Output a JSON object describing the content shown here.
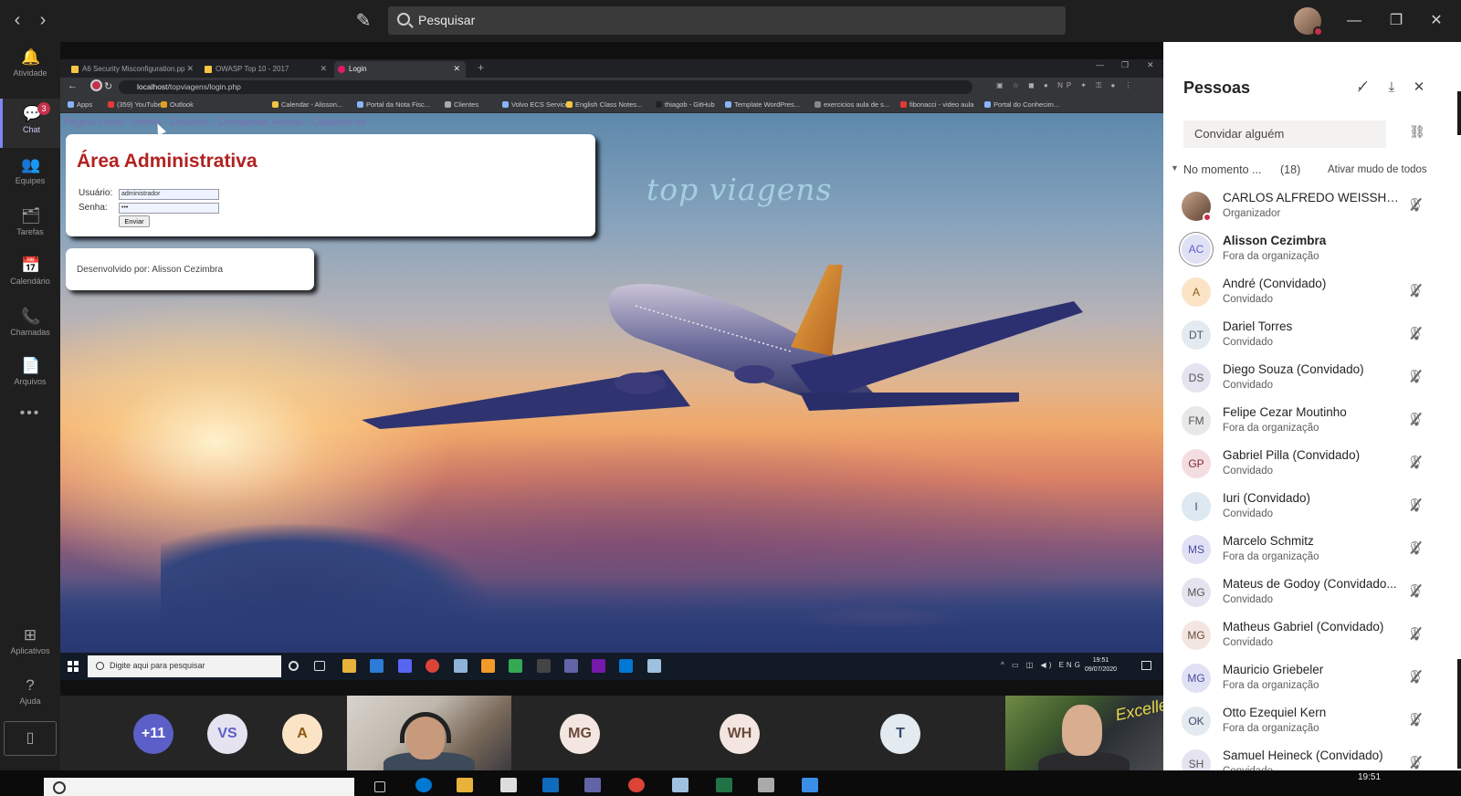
{
  "teams": {
    "search_placeholder": "Pesquisar",
    "rail": [
      {
        "label": "Atividade",
        "icon": "bell-icon",
        "glyph": "🔔"
      },
      {
        "label": "Chat",
        "icon": "chat-icon",
        "glyph": "💬",
        "badge": "3"
      },
      {
        "label": "Equipes",
        "icon": "teams-icon",
        "glyph": "👥"
      },
      {
        "label": "Tarefas",
        "icon": "tasks-icon",
        "glyph": "🗂"
      },
      {
        "label": "Calendário",
        "icon": "calendar-icon",
        "glyph": "📅"
      },
      {
        "label": "Chamadas",
        "icon": "phone-icon",
        "glyph": "📞"
      },
      {
        "label": "Arquivos",
        "icon": "files-icon",
        "glyph": "📄"
      },
      {
        "label": "Aplicativos",
        "icon": "apps-icon",
        "glyph": "⊞"
      },
      {
        "label": "Ajuda",
        "icon": "help-icon",
        "glyph": "?"
      }
    ]
  },
  "browser": {
    "tabs": [
      {
        "title": "A6 Security Misconfiguration.pp"
      },
      {
        "title": "OWASP Top 10 - 2017"
      },
      {
        "title": "Login"
      }
    ],
    "url_host": "localhost",
    "url_path": "/topviagens/login.php",
    "bookmarks": [
      "Apps",
      "(359) YouTube",
      "Outlook",
      "Calendar - Alisson...",
      "Portal da Nota Fisc...",
      "Clientes",
      "Volvo ECS Service",
      "English Class Notes...",
      "thiagob - GitHub",
      "Template WordPres...",
      "exercicios aula de s...",
      "fibonacci - video aula",
      "Portal do Conhecim..."
    ]
  },
  "site": {
    "nav": [
      "Página Inicial",
      "Hotéis",
      "Destinos",
      "Companias Aéreas",
      "Cadastre-se"
    ],
    "nav_separator": " - ",
    "admin_title": "Área Administrativa",
    "user_label": "Usuário:",
    "user_value": "administrador",
    "pass_label": "Senha:",
    "pass_value": "•••",
    "submit_label": "Enviar",
    "developer": "Desenvolvido por: Alisson Cezimbra",
    "brand": "top viagens"
  },
  "win_taskbar": {
    "search_placeholder": "Digite aqui para pesquisar",
    "lang": "ENG",
    "time": "19:51",
    "date": "09/07/2020"
  },
  "strip": {
    "participants": [
      "+11",
      "VS",
      "A",
      "MG",
      "WH",
      "T"
    ],
    "video2_text": "Excellent"
  },
  "host_clock": "19:51",
  "people": {
    "title": "Pessoas",
    "invite_placeholder": "Convidar alguém",
    "section_title": "No momento ...",
    "section_count": "(18)",
    "mute_all": "Ativar mudo de todos",
    "list": [
      {
        "initials": "",
        "name": "CARLOS ALFREDO WEISSHEI...",
        "role": "Organizador",
        "photo": true
      },
      {
        "initials": "AC",
        "name": "Alisson Cezimbra",
        "role": "Fora da organização",
        "bold": true
      },
      {
        "initials": "A",
        "name": "André (Convidado)",
        "role": "Convidado",
        "color": "#fbe4c6",
        "fg": "#8a5a10"
      },
      {
        "initials": "DT",
        "name": "Dariel Torres",
        "role": "Convidado",
        "color": "#e3eaf0",
        "fg": "#4a5a6a"
      },
      {
        "initials": "DS",
        "name": "Diego Souza (Convidado)",
        "role": "Convidado",
        "color": "#e6e3f0",
        "fg": "#555"
      },
      {
        "initials": "FM",
        "name": "Felipe Cezar Moutinho",
        "role": "Fora da organização",
        "color": "#e8e8e8",
        "fg": "#555"
      },
      {
        "initials": "GP",
        "name": "Gabriel Pilla (Convidado)",
        "role": "Convidado",
        "color": "#f4dde0",
        "fg": "#7a2a34"
      },
      {
        "initials": "I",
        "name": "Iuri (Convidado)",
        "role": "Convidado",
        "color": "#dde8f0",
        "fg": "#2a4a6a"
      },
      {
        "initials": "MS",
        "name": "Marcelo Schmitz",
        "role": "Fora da organização",
        "color": "#e1e1f5",
        "fg": "#4a4aa0"
      },
      {
        "initials": "MG",
        "name": "Mateus de Godoy (Convidado...",
        "role": "Convidado",
        "color": "#e6e3f0",
        "fg": "#555"
      },
      {
        "initials": "MG",
        "name": "Matheus Gabriel (Convidado)",
        "role": "Convidado",
        "color": "#f3e6e0",
        "fg": "#6a4a3a"
      },
      {
        "initials": "MG",
        "name": "Mauricio Griebeler",
        "role": "Fora da organização",
        "color": "#e1e1f5",
        "fg": "#4a4aa0"
      },
      {
        "initials": "OK",
        "name": "Otto Ezequiel Kern",
        "role": "Fora da organização",
        "color": "#e3eaf0",
        "fg": "#3a4a6a"
      },
      {
        "initials": "SH",
        "name": "Samuel Heineck (Convidado)",
        "role": "Convidado",
        "color": "#e6e3f0",
        "fg": "#555"
      }
    ]
  }
}
